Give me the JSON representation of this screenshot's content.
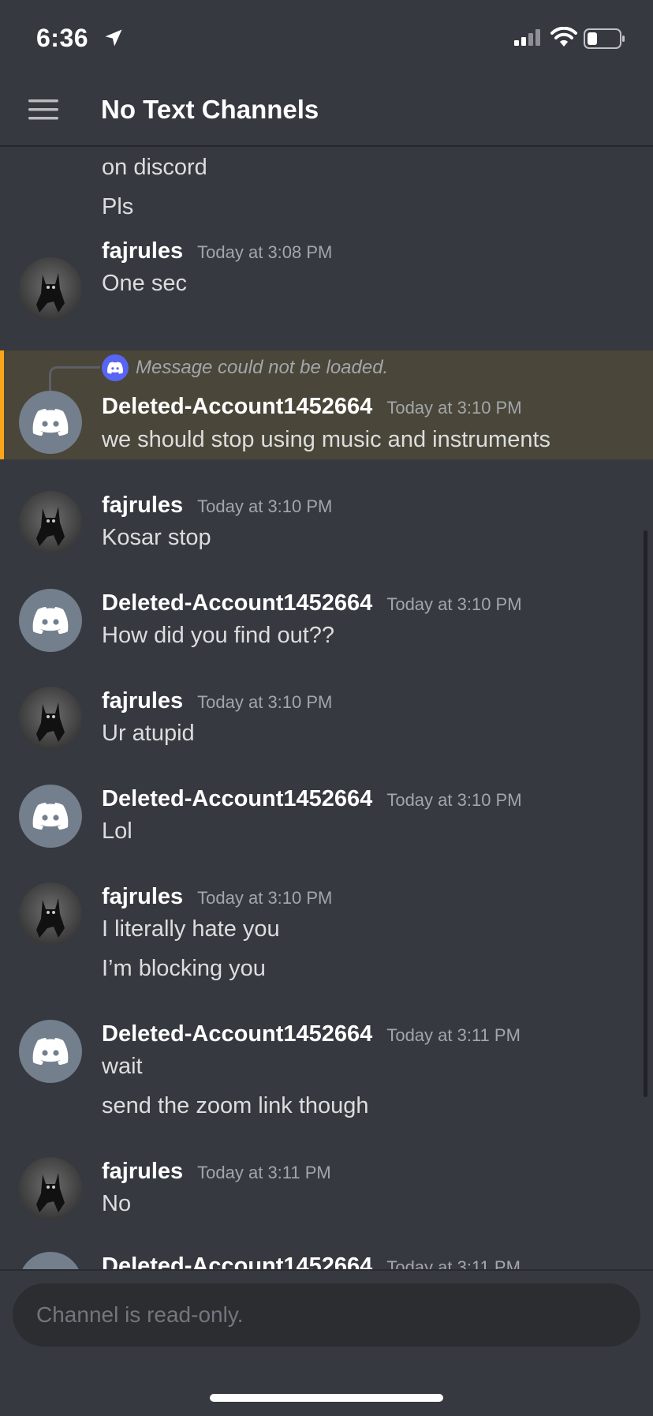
{
  "status_bar": {
    "time": "6:36",
    "location_icon": "location-arrow-icon",
    "signal_icon": "cellular-signal-icon",
    "wifi_icon": "wifi-icon",
    "battery_icon": "battery-low-icon"
  },
  "header": {
    "menu_icon": "hamburger-menu-icon",
    "title": "No Text Channels"
  },
  "messages": {
    "prev_lines": [
      "on discord",
      "Pls"
    ],
    "items": [
      {
        "author": "fajrules",
        "timestamp": "Today at 3:08 PM",
        "lines": [
          "One sec"
        ],
        "avatar": "cat"
      },
      {
        "reply_text": "Message could not be loaded.",
        "author": "Deleted-Account1452664",
        "timestamp": "Today at 3:10 PM",
        "lines": [
          "we should stop using music and instruments"
        ],
        "avatar": "discord",
        "highlighted": true
      },
      {
        "author": "fajrules",
        "timestamp": "Today at 3:10 PM",
        "lines": [
          "Kosar stop"
        ],
        "avatar": "cat"
      },
      {
        "author": "Deleted-Account1452664",
        "timestamp": "Today at 3:10 PM",
        "lines": [
          "How did you find out??"
        ],
        "avatar": "discord"
      },
      {
        "author": "fajrules",
        "timestamp": "Today at 3:10 PM",
        "lines": [
          "Ur atupid"
        ],
        "avatar": "cat"
      },
      {
        "author": "Deleted-Account1452664",
        "timestamp": "Today at 3:10 PM",
        "lines": [
          "Lol"
        ],
        "avatar": "discord"
      },
      {
        "author": "fajrules",
        "timestamp": "Today at 3:10 PM",
        "lines": [
          "I literally hate you",
          "I’m blocking you"
        ],
        "avatar": "cat"
      },
      {
        "author": "Deleted-Account1452664",
        "timestamp": "Today at 3:11 PM",
        "lines": [
          "wait",
          "send the zoom link though"
        ],
        "avatar": "discord"
      },
      {
        "author": "fajrules",
        "timestamp": "Today at 3:11 PM",
        "lines": [
          "No"
        ],
        "avatar": "cat"
      },
      {
        "author": "Deleted-Account1452664",
        "timestamp": "Today at 3:11 PM",
        "lines": [],
        "avatar": "discord"
      }
    ]
  },
  "composer": {
    "placeholder": "Channel is read-only."
  },
  "colors": {
    "background": "#36393f",
    "highlight": "#4a4639",
    "highlight_border": "#faa61a",
    "discord_blurple": "#5865f2",
    "avatar_gray": "#747f8d"
  }
}
